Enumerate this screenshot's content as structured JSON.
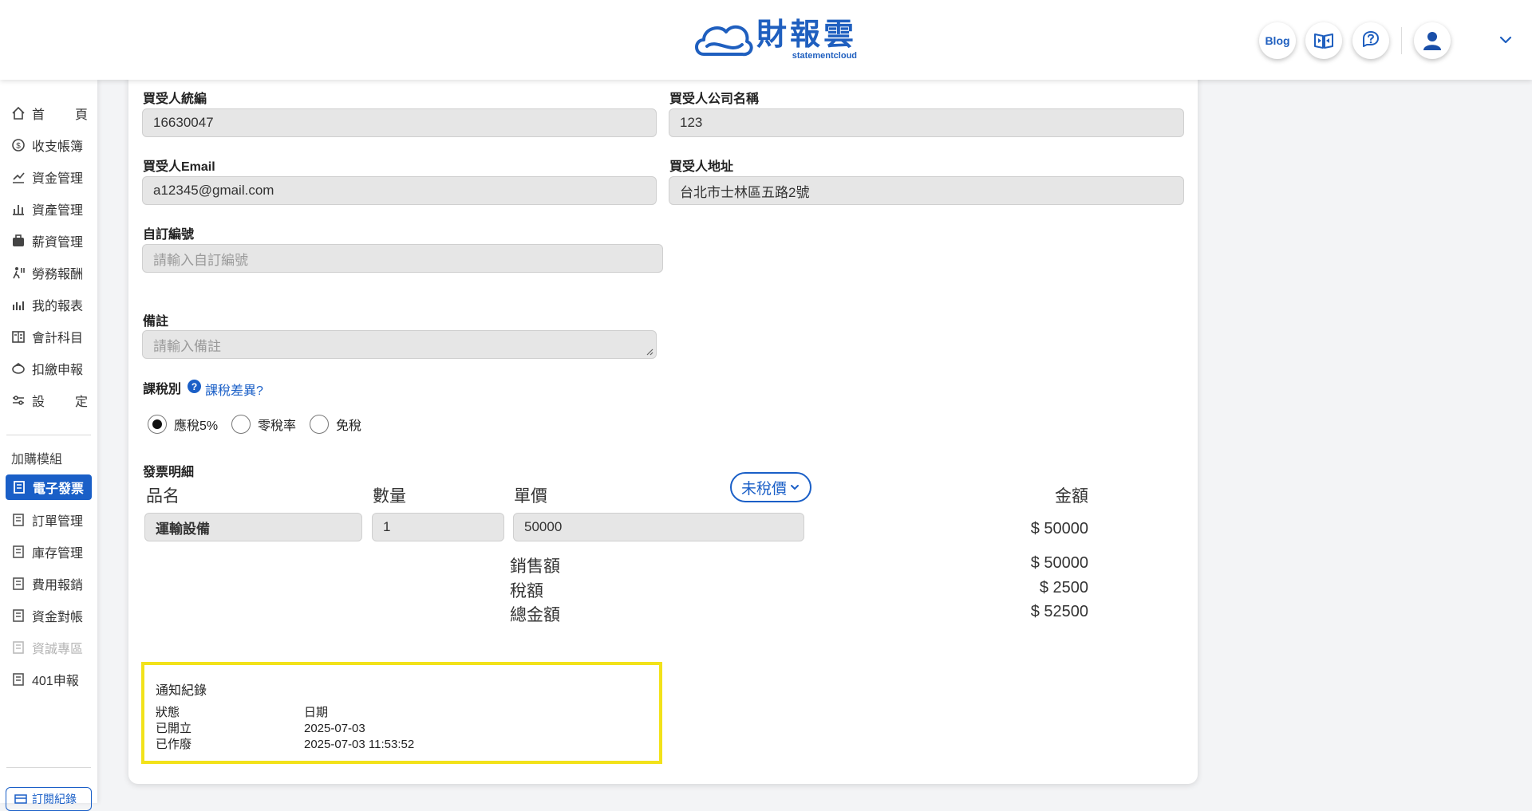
{
  "header": {
    "brand_cn": "財報雲",
    "brand_en": "statementcloud",
    "blog_label": "Blog"
  },
  "sidebar": {
    "items": [
      {
        "label_a": "首",
        "label_b": "頁",
        "icon": "home-icon"
      },
      {
        "label": "收支帳簿",
        "icon": "coin-icon"
      },
      {
        "label": "資金管理",
        "icon": "fund-icon"
      },
      {
        "label": "資產管理",
        "icon": "scale-icon"
      },
      {
        "label": "薪資管理",
        "icon": "payroll-icon"
      },
      {
        "label": "勞務報酬",
        "icon": "labor-icon"
      },
      {
        "label": "我的報表",
        "icon": "chart-icon"
      },
      {
        "label": "會計科目",
        "icon": "ledger-icon"
      },
      {
        "label": "扣繳申報",
        "icon": "withholding-icon"
      },
      {
        "label_a": "設",
        "label_b": "定",
        "icon": "settings-icon"
      }
    ],
    "section_title": "加購模組",
    "modules": [
      {
        "label": "電子發票",
        "active": true
      },
      {
        "label": "訂單管理"
      },
      {
        "label": "庫存管理"
      },
      {
        "label": "費用報銷"
      },
      {
        "label": "資金對帳"
      },
      {
        "label": "資誠專區",
        "disabled": true
      },
      {
        "label": "401申報"
      }
    ],
    "subscription_label": "訂閱紀錄"
  },
  "form": {
    "buyer_tax_id_label": "買受人統編",
    "buyer_tax_id": "16630047",
    "buyer_company_label": "買受人公司名稱",
    "buyer_company": "123",
    "buyer_email_label": "買受人Email",
    "buyer_email": "a12345@gmail.com",
    "buyer_address_label": "買受人地址",
    "buyer_address": "台北市士林區五路2號",
    "custom_no_label": "自訂編號",
    "custom_no_placeholder": "請輸入自訂編號",
    "note_label": "備註",
    "note_placeholder": "請輸入備註",
    "tax_type_label": "課稅別",
    "tax_help_link": "課稅差異?",
    "tax_options": [
      "應稅5%",
      "零稅率",
      "免稅"
    ],
    "tax_selected": "應稅5%"
  },
  "invoice": {
    "section_label": "發票明細",
    "col_name": "品名",
    "col_qty": "數量",
    "col_price": "單價",
    "price_mode": "未稅價",
    "col_amount": "金額",
    "item": {
      "name": "運輸設備",
      "qty": "1",
      "price": "50000",
      "amount": "$ 50000"
    },
    "sales_label": "銷售額",
    "sales": "$ 50000",
    "tax_label": "稅額",
    "tax": "$ 2500",
    "total_label": "總金額",
    "total": "$ 52500"
  },
  "notifications": {
    "title": "通知紀錄",
    "col_status": "狀態",
    "col_date": "日期",
    "rows": [
      {
        "status": "已開立",
        "date": "2025-07-03"
      },
      {
        "status": "已作廢",
        "date": "2025-07-03 11:53:52"
      }
    ]
  },
  "colors": {
    "primary": "#1a5fc7",
    "highlight_border": "#f2e21a"
  }
}
